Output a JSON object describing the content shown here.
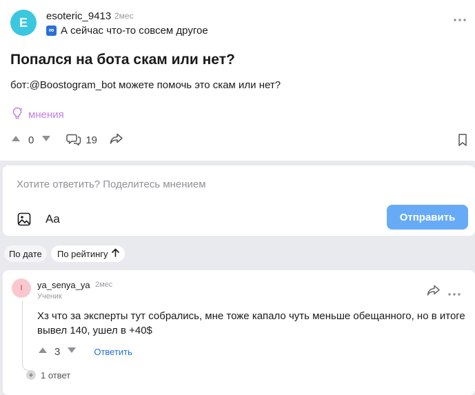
{
  "post": {
    "avatar_letter": "E",
    "author": "esoteric_9413",
    "time": "2мес",
    "category_icon": "∞",
    "category": "А сейчас что-то совсем другое",
    "title": "Попался на бота скам или нет?",
    "body": "бот:@Boostogram_bot можете помочь это скам или нет?",
    "opinions_label": "мнения",
    "votes": "0",
    "comments": "19"
  },
  "reply_box": {
    "placeholder": "Хотите ответить? Поделитесь мнением",
    "format_label": "Aa",
    "send_label": "Отправить"
  },
  "sort": {
    "by_date": "По дате",
    "by_rating": "По рейтингу"
  },
  "comment": {
    "avatar_letter": "I",
    "author": "ya_senya_ya",
    "time": "2мес",
    "role": "Ученик",
    "text": "Хз что за эксперты тут собрались, мне тоже капало чуть меньше обещанного, но в итоге вывел 140, ушел в +40$",
    "votes": "3",
    "reply_label": "Ответить",
    "replies_label": "1 ответ"
  },
  "colors": {
    "accent": "#67abf7",
    "link": "#1f6fd6",
    "opinions": "#c07ee6",
    "post_avatar": "#3bc7df",
    "comment_avatar": "#f9c8cf"
  }
}
